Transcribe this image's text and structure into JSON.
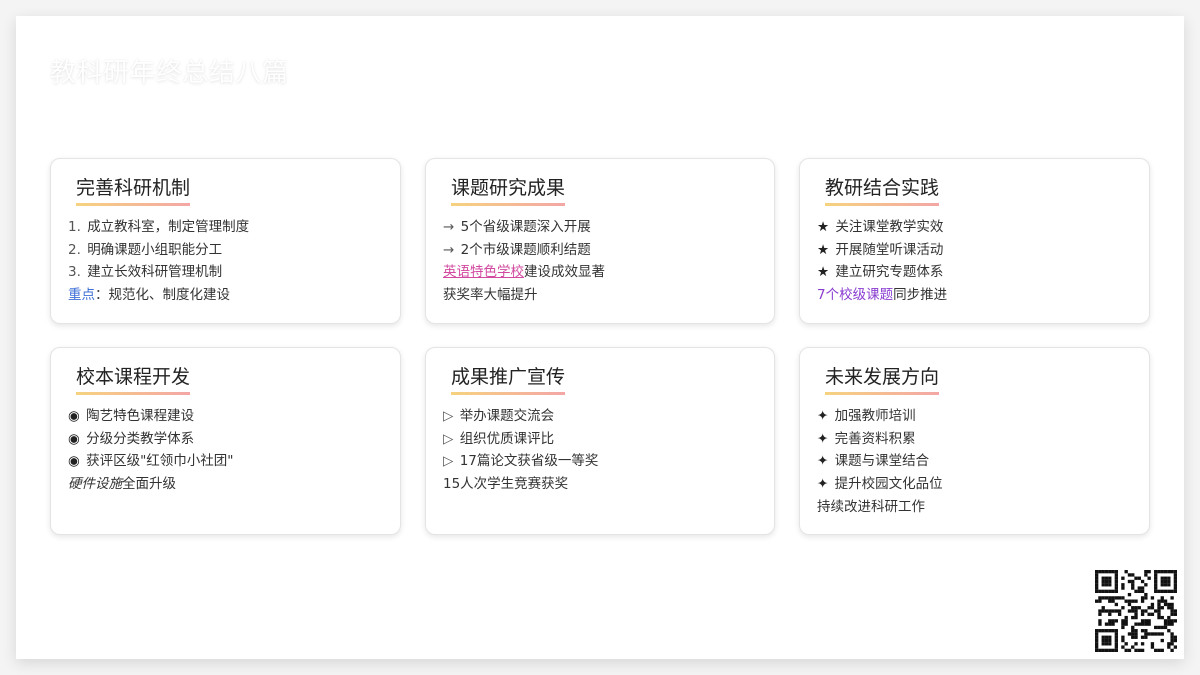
{
  "title": "教科研年终总结八篇",
  "cards": [
    {
      "title": "完善科研机制",
      "items": [
        {
          "prefix": "1.",
          "text": "成立教科室，制定管理制度"
        },
        {
          "prefix": "2.",
          "text": "明确课题小组职能分工"
        },
        {
          "prefix": "3.",
          "text": "建立长效科研管理机制"
        },
        {
          "highlight": "重点",
          "text": "：规范化、制度化建设"
        }
      ]
    },
    {
      "title": "课题研究成果",
      "items": [
        {
          "prefix": "→",
          "text": "5个省级课题深入开展"
        },
        {
          "prefix": "→",
          "text": "2个市级课题顺利结题"
        },
        {
          "highlight": "英语特色学校",
          "text": "建设成效显著"
        },
        {
          "text": "获奖率大幅提升"
        }
      ]
    },
    {
      "title": "教研结合实践",
      "items": [
        {
          "prefix": "★",
          "text": "关注课堂教学实效"
        },
        {
          "prefix": "★",
          "text": "开展随堂听课活动"
        },
        {
          "prefix": "★",
          "text": "建立研究专题体系"
        },
        {
          "highlight": "7个校级课题",
          "text": "同步推进"
        }
      ]
    },
    {
      "title": "校本课程开发",
      "items": [
        {
          "prefix": "◉",
          "text": "陶艺特色课程建设"
        },
        {
          "prefix": "◉",
          "text": "分级分类教学体系"
        },
        {
          "prefix": "◉",
          "text": "获评区级\"红领巾小社团\""
        },
        {
          "highlight": "硬件设施",
          "text": "全面升级"
        }
      ]
    },
    {
      "title": "成果推广宣传",
      "items": [
        {
          "prefix": "▷",
          "text": "举办课题交流会"
        },
        {
          "prefix": "▷",
          "text": "组织优质课评比"
        },
        {
          "prefix": "▷",
          "text": "17篇论文获省级一等奖"
        },
        {
          "text": "15人次学生竞赛获奖"
        }
      ]
    },
    {
      "title": "未来发展方向",
      "items": [
        {
          "prefix": "✦",
          "text": "加强教师培训"
        },
        {
          "prefix": "✦",
          "text": "完善资料积累"
        },
        {
          "prefix": "✦",
          "text": "课题与课堂结合"
        },
        {
          "prefix": "✦",
          "text": "提升校园文化品位"
        },
        {
          "text": "持续改进科研工作"
        }
      ]
    }
  ],
  "colors": {
    "highlight_blue": "#3e6fd6",
    "highlight_pink": "#d24aa0",
    "highlight_purple": "#8a3cd0",
    "title_underline_start": "#f6d37f",
    "title_underline_end": "#f4a6a6"
  },
  "qr_icon": "qr-code-icon"
}
